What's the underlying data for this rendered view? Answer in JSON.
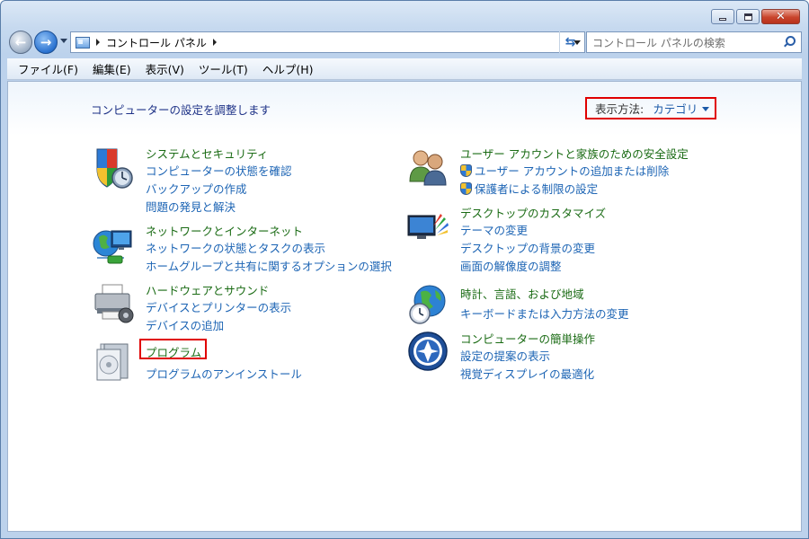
{
  "window": {
    "caption": {
      "minimize": "minimize",
      "maximize": "maximize",
      "close": "close"
    }
  },
  "address": {
    "breadcrumb": [
      "コントロール パネル"
    ],
    "search_placeholder": "コントロール パネルの検索"
  },
  "menu": [
    "ファイル(F)",
    "編集(E)",
    "表示(V)",
    "ツール(T)",
    "ヘルプ(H)"
  ],
  "content": {
    "heading": "コンピューターの設定を調整します",
    "view_by_label": "表示方法:",
    "view_by_value": "カテゴリ"
  },
  "categories": {
    "system": {
      "title": "システムとセキュリティ",
      "links": [
        "コンピューターの状態を確認",
        "バックアップの作成",
        "問題の発見と解決"
      ],
      "icon": "shield-clock-icon"
    },
    "network": {
      "title": "ネットワークとインターネット",
      "links": [
        "ネットワークの状態とタスクの表示",
        "ホームグループと共有に関するオプションの選択"
      ],
      "icon": "globe-network-icon"
    },
    "hardware": {
      "title": "ハードウェアとサウンド",
      "links": [
        "デバイスとプリンターの表示",
        "デバイスの追加"
      ],
      "icon": "printer-icon"
    },
    "programs": {
      "title": "プログラム",
      "links": [
        "プログラムのアンインストール"
      ],
      "icon": "programs-icon"
    },
    "users": {
      "title": "ユーザー アカウントと家族のための安全設定",
      "links": [
        "ユーザー アカウントの追加または削除",
        "保護者による制限の設定"
      ],
      "icon": "users-icon"
    },
    "appearance": {
      "title": "デスクトップのカスタマイズ",
      "links": [
        "テーマの変更",
        "デスクトップの背景の変更",
        "画面の解像度の調整"
      ],
      "icon": "monitor-palette-icon"
    },
    "clock": {
      "title": "時計、言語、および地域",
      "links": [
        "キーボードまたは入力方法の変更"
      ],
      "icon": "globe-clock-icon"
    },
    "ease": {
      "title": "コンピューターの簡単操作",
      "links": [
        "設定の提案の表示",
        "視覚ディスプレイの最適化"
      ],
      "icon": "ease-of-access-icon"
    }
  },
  "colors": {
    "category_title": "#1a6b14",
    "link": "#1c64b4",
    "highlight_box": "#e00000"
  }
}
